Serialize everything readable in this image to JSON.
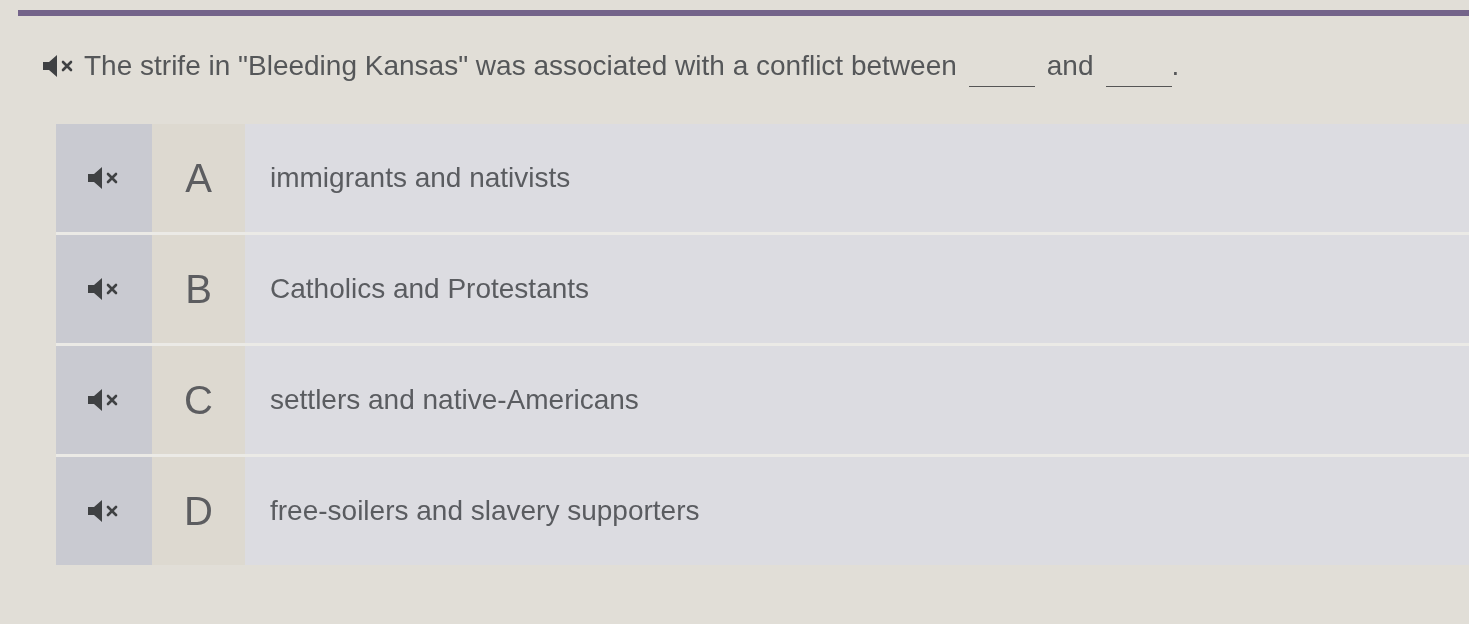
{
  "question": {
    "segments": [
      {
        "kind": "text",
        "text": "The strife in \"Bleeding Kansas\" was associated with a conflict between"
      },
      {
        "kind": "blank"
      },
      {
        "kind": "text",
        "text": "and"
      },
      {
        "kind": "blank"
      },
      {
        "kind": "text",
        "text": "."
      }
    ]
  },
  "options": [
    {
      "letter": "A",
      "text": "immigrants and nativists",
      "selected": false
    },
    {
      "letter": "B",
      "text": "Catholics and Protestants",
      "selected": false
    },
    {
      "letter": "C",
      "text": "settlers and native-Americans",
      "selected": false
    },
    {
      "letter": "D",
      "text": "free-soilers and slavery supporters",
      "selected": false
    }
  ]
}
